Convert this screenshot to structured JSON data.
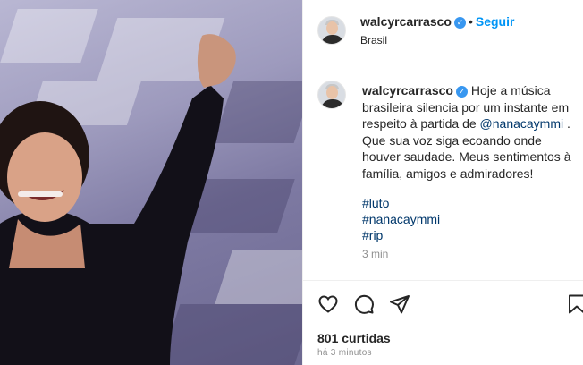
{
  "post": {
    "username": "walcyrcarrasco",
    "follow_label": "Seguir",
    "separator": "•",
    "location": "Brasil",
    "caption_intro": " Hoje a música brasileira silencia por um instante em respeito à partida de ",
    "mention": "@nanacaymmi",
    "caption_outro": " . Que sua voz siga ecoando onde houver saudade. Meus sentimentos à família, amigos e admiradores!",
    "hashtags": [
      "#luto",
      "#nanacaymmi",
      "#rip"
    ],
    "caption_time": "3 min",
    "likes": "801 curtidas",
    "post_time": "há 3 minutos"
  },
  "icons": {
    "verified": "verified-badge-icon",
    "like": "heart-icon",
    "comment": "comment-icon",
    "share": "send-icon",
    "save": "bookmark-icon"
  },
  "colors": {
    "link_blue": "#0095f6",
    "hashtag": "#00376b",
    "verified": "#3897f0"
  }
}
